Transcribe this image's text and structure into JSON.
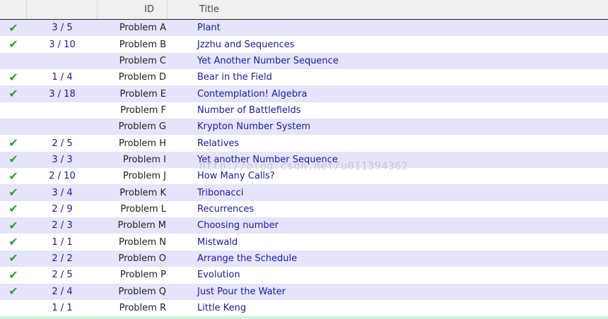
{
  "table": {
    "headers": {
      "status": "",
      "ratio": "",
      "id": "ID",
      "title": "Title"
    },
    "rows": [
      {
        "solved": true,
        "ratio": "3 / 5",
        "id": "Problem A",
        "title": "Plant"
      },
      {
        "solved": true,
        "ratio": "3 / 10",
        "id": "Problem B",
        "title": "Jzzhu and Sequences"
      },
      {
        "solved": false,
        "ratio": "",
        "id": "Problem C",
        "title": "Yet Another Number Sequence"
      },
      {
        "solved": true,
        "ratio": "1 / 4",
        "id": "Problem D",
        "title": "Bear in the Field"
      },
      {
        "solved": true,
        "ratio": "3 / 18",
        "id": "Problem E",
        "title": "Contemplation! Algebra"
      },
      {
        "solved": false,
        "ratio": "",
        "id": "Problem F",
        "title": "Number of Battlefields"
      },
      {
        "solved": false,
        "ratio": "",
        "id": "Problem G",
        "title": "Krypton Number System"
      },
      {
        "solved": true,
        "ratio": "2 / 5",
        "id": "Problem H",
        "title": "Relatives"
      },
      {
        "solved": true,
        "ratio": "3 / 3",
        "id": "Problem I",
        "title": "Yet another Number Sequence"
      },
      {
        "solved": true,
        "ratio": "2 / 10",
        "id": "Problem J",
        "title": "How Many Calls?"
      },
      {
        "solved": true,
        "ratio": "3 / 4",
        "id": "Problem K",
        "title": "Tribonacci"
      },
      {
        "solved": true,
        "ratio": "2 / 9",
        "id": "Problem L",
        "title": "Recurrences"
      },
      {
        "solved": true,
        "ratio": "2 / 3",
        "id": "Problem M",
        "title": "Choosing number"
      },
      {
        "solved": true,
        "ratio": "1 / 1",
        "id": "Problem N",
        "title": "Mistwald"
      },
      {
        "solved": true,
        "ratio": "2 / 2",
        "id": "Problem O",
        "title": "Arrange the Schedule"
      },
      {
        "solved": true,
        "ratio": "2 / 5",
        "id": "Problem P",
        "title": "Evolution"
      },
      {
        "solved": true,
        "ratio": "2 / 4",
        "id": "Problem Q",
        "title": "Just Pour the Water"
      },
      {
        "solved": false,
        "ratio": "1 / 1",
        "id": "Problem R",
        "title": "Little Keng"
      }
    ]
  },
  "icons": {
    "solved": "check-icon"
  },
  "colors": {
    "row_alt": "#e4e4fb",
    "link": "#1a1aa6",
    "check": "#2aa32a"
  },
  "watermark": "http://blog.csdn.net/u011394362"
}
